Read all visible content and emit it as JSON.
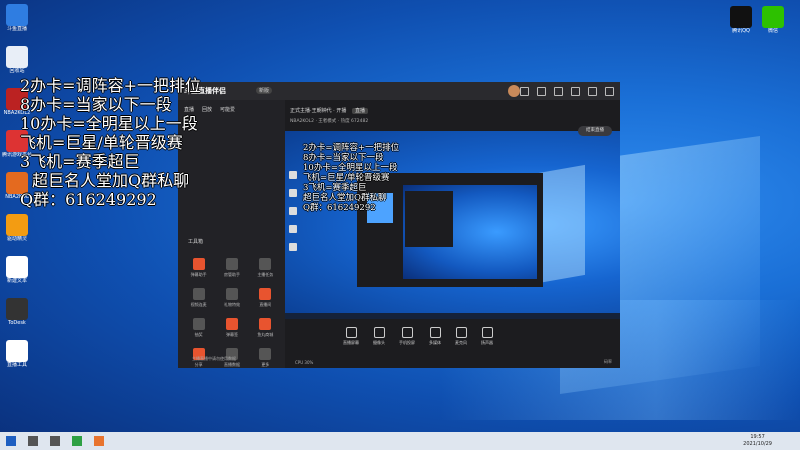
{
  "overlay_lines": [
    "2办卡=调阵容+一把排位",
    "8办卡=当家以下一段",
    "10办卡=全明星以上一段",
    "飞机=巨星/单轮晋级赛",
    "3飞机=赛季超巨",
    "超巨名人堂加Q群私聊",
    "Q群：616249292"
  ],
  "desktop_left": [
    {
      "label": "斗鱼直播",
      "icon": "douyu-icon",
      "color": "#2f7de1"
    },
    {
      "label": "回收站",
      "icon": "recycle-bin-icon",
      "color": "#e8eef7"
    },
    {
      "label": "NBA2KOL2",
      "icon": "nba-icon",
      "color": "#b22"
    },
    {
      "label": "腾讯游戏平台",
      "icon": "tencent-game-icon",
      "color": "#d33"
    },
    {
      "label": "NBA2KOL",
      "icon": "basketball-icon",
      "color": "#e46a1f"
    },
    {
      "label": "驱动精灵",
      "icon": "driver-icon",
      "color": "#f39c12"
    },
    {
      "label": "新建文本",
      "icon": "document-icon",
      "color": "#ffffff"
    },
    {
      "label": "ToDesk",
      "icon": "todesk-icon",
      "color": "#333"
    },
    {
      "label": "直播工具",
      "icon": "file-icon",
      "color": "#ffffff"
    }
  ],
  "desktop_right": [
    {
      "label": "腾讯QQ",
      "icon": "qq-icon",
      "color": "#111"
    },
    {
      "label": "微信",
      "icon": "wechat-icon",
      "color": "#2dc100"
    }
  ],
  "app": {
    "logo": "斗鱼直播伴侣",
    "version": "新版",
    "tabs": [
      "直播",
      "回放",
      "可能爱"
    ],
    "stream_title": "正式主播·王朝钟代 · 开播",
    "stream_tag": "直播",
    "room_info": "NBA2KOL2 · 王者模式 · 热度 672482",
    "tools_header": "工具箱",
    "tools": [
      {
        "label": "弹幕助手",
        "icon": "danmaku-icon",
        "accent": true
      },
      {
        "label": "房管助手",
        "icon": "admin-icon",
        "accent": false
      },
      {
        "label": "主播任务",
        "icon": "task-icon",
        "accent": false
      },
      {
        "label": "视频连麦",
        "icon": "video-link-icon",
        "accent": false
      },
      {
        "label": "礼物特效",
        "icon": "gift-icon",
        "accent": false
      },
      {
        "label": "直播间",
        "icon": "room-icon",
        "accent": true
      },
      {
        "label": "抽奖",
        "icon": "lottery-icon",
        "accent": false
      },
      {
        "label": "弹幕签",
        "icon": "sign-icon",
        "accent": true
      },
      {
        "label": "鱼丸商城",
        "icon": "shop-icon",
        "accent": true
      },
      {
        "label": "分享",
        "icon": "share-icon",
        "accent": true
      },
      {
        "label": "直播数据",
        "icon": "data-icon",
        "accent": false
      },
      {
        "label": "更多",
        "icon": "more-icon",
        "accent": false
      }
    ],
    "footer_note": "主播直播中请勿使用数据",
    "controls": [
      "直播屏幕",
      "摄像头",
      "手机投屏",
      "多媒体",
      "麦克风",
      "扬声器"
    ],
    "start_label": "结束直播",
    "status_left": "CPU 30%",
    "status_right": "码率"
  },
  "taskbar": {
    "time": "19:57",
    "date": "2021/10/29",
    "icons": [
      "windows-icon",
      "search-icon",
      "task-view-icon",
      "browser-icon",
      "douyu-task-icon"
    ]
  }
}
